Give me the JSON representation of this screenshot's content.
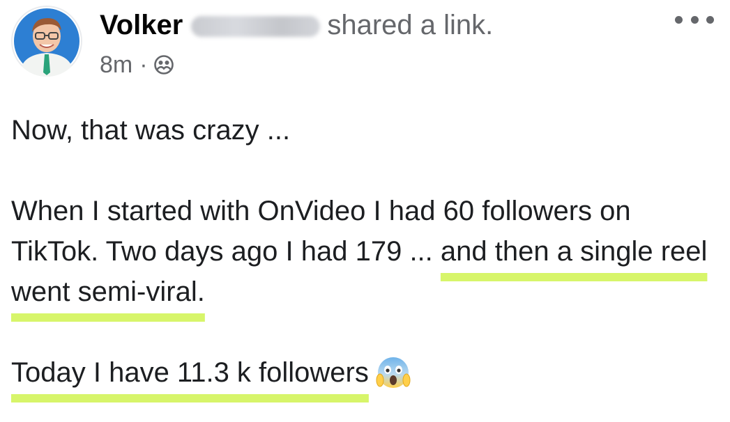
{
  "post": {
    "author": {
      "first_name": "Volker",
      "last_name_hidden": "Kläschen",
      "avatar": "avatar-icon"
    },
    "action": "shared a link.",
    "timestamp": "8m",
    "separator": "·",
    "audience_icon": "friends-icon",
    "more_icon": "more-options-icon",
    "body": {
      "line1": "Now, that was crazy ...",
      "para2_plain": "When I started with OnVideo I had 60 followers on TikTok. Two days ago I had 179 ... ",
      "para2_highlight": "and then a single reel went semi-viral.",
      "para3_highlight": "Today I have 11.3 k followers",
      "para3_emoji": "face-screaming-in-fear-emoji"
    },
    "colors": {
      "highlight": "#d7f56a",
      "secondary_text": "#65676b",
      "primary_text": "#1c1e21"
    }
  }
}
